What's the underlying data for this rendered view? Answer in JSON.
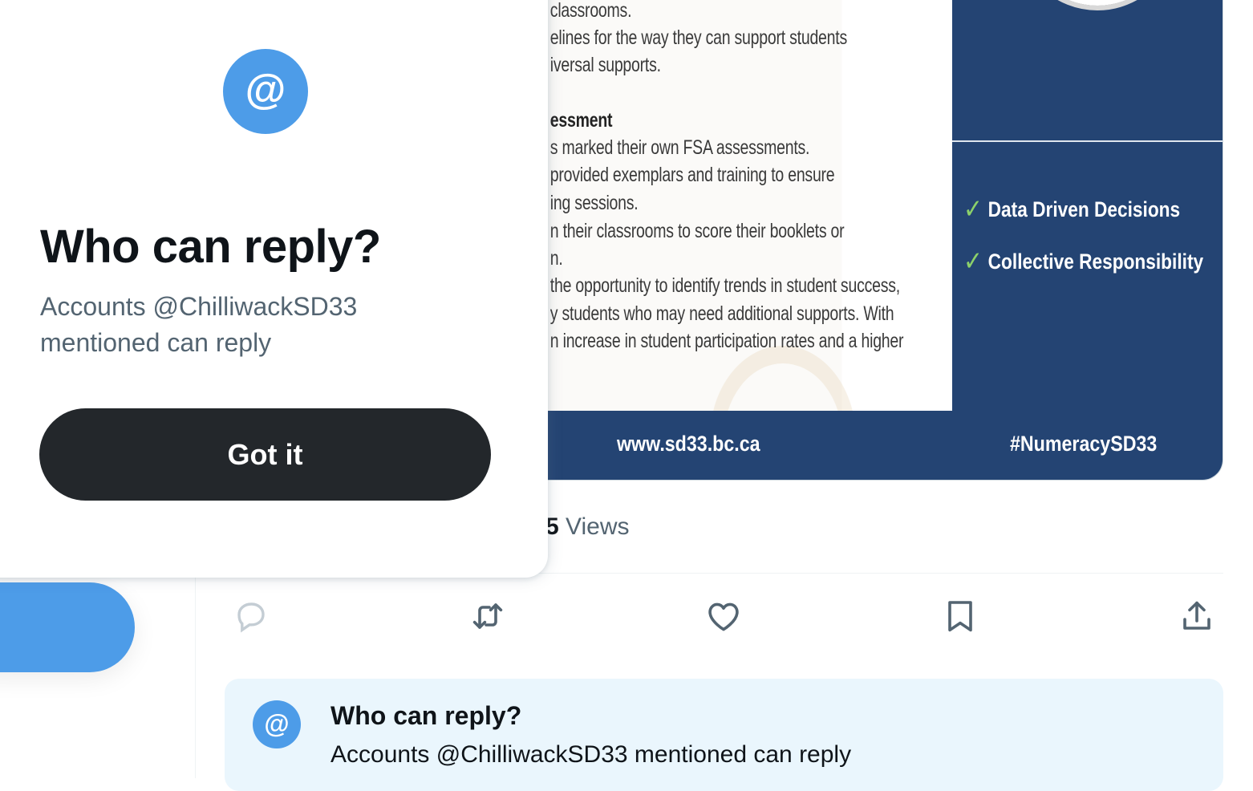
{
  "popup": {
    "icon": "@",
    "title": "Who can reply?",
    "description": "Accounts @ChilliwackSD33 mentioned can reply",
    "button_label": "Got it"
  },
  "media": {
    "text_lines": [
      {
        "text": "classrooms.",
        "heading": false
      },
      {
        "text": "elines for the way they can support students",
        "heading": false
      },
      {
        "text": "iversal supports.",
        "heading": false
      },
      {
        "text": "essment",
        "heading": true
      },
      {
        "text": "s marked their own FSA assessments.",
        "heading": false
      },
      {
        "text": "provided exemplars and training to ensure",
        "heading": false
      },
      {
        "text": "ing sessions.",
        "heading": false
      },
      {
        "text": "n their classrooms to score their booklets or",
        "heading": false
      },
      {
        "text": "n.",
        "heading": false
      },
      {
        "text": "the opportunity to identify trends in student success,",
        "heading": false
      },
      {
        "text": "y students who may need additional supports. With",
        "heading": false
      },
      {
        "text": "n increase in student participation rates and a higher",
        "heading": false
      }
    ],
    "checklist": [
      "Data Driven Decisions",
      "Collective Responsibility"
    ],
    "footer_url": "www.sd33.bc.ca",
    "footer_hashtag": "#NumeracySD33",
    "accent_color": "#244473",
    "check_color": "#8cd16a"
  },
  "views": {
    "count_partial": "5",
    "label": "Views"
  },
  "actions": [
    "reply-icon",
    "retweet-icon",
    "like-icon",
    "bookmark-icon",
    "share-icon"
  ],
  "reply_banner": {
    "icon": "@",
    "title": "Who can reply?",
    "subtitle": "Accounts @ChilliwackSD33 mentioned can reply"
  },
  "colors": {
    "brand_blue": "#4d9ce8",
    "text_primary": "#0f1419",
    "text_secondary": "#536471",
    "button_dark": "#23272b",
    "banner_bg": "#eaf6fd"
  }
}
